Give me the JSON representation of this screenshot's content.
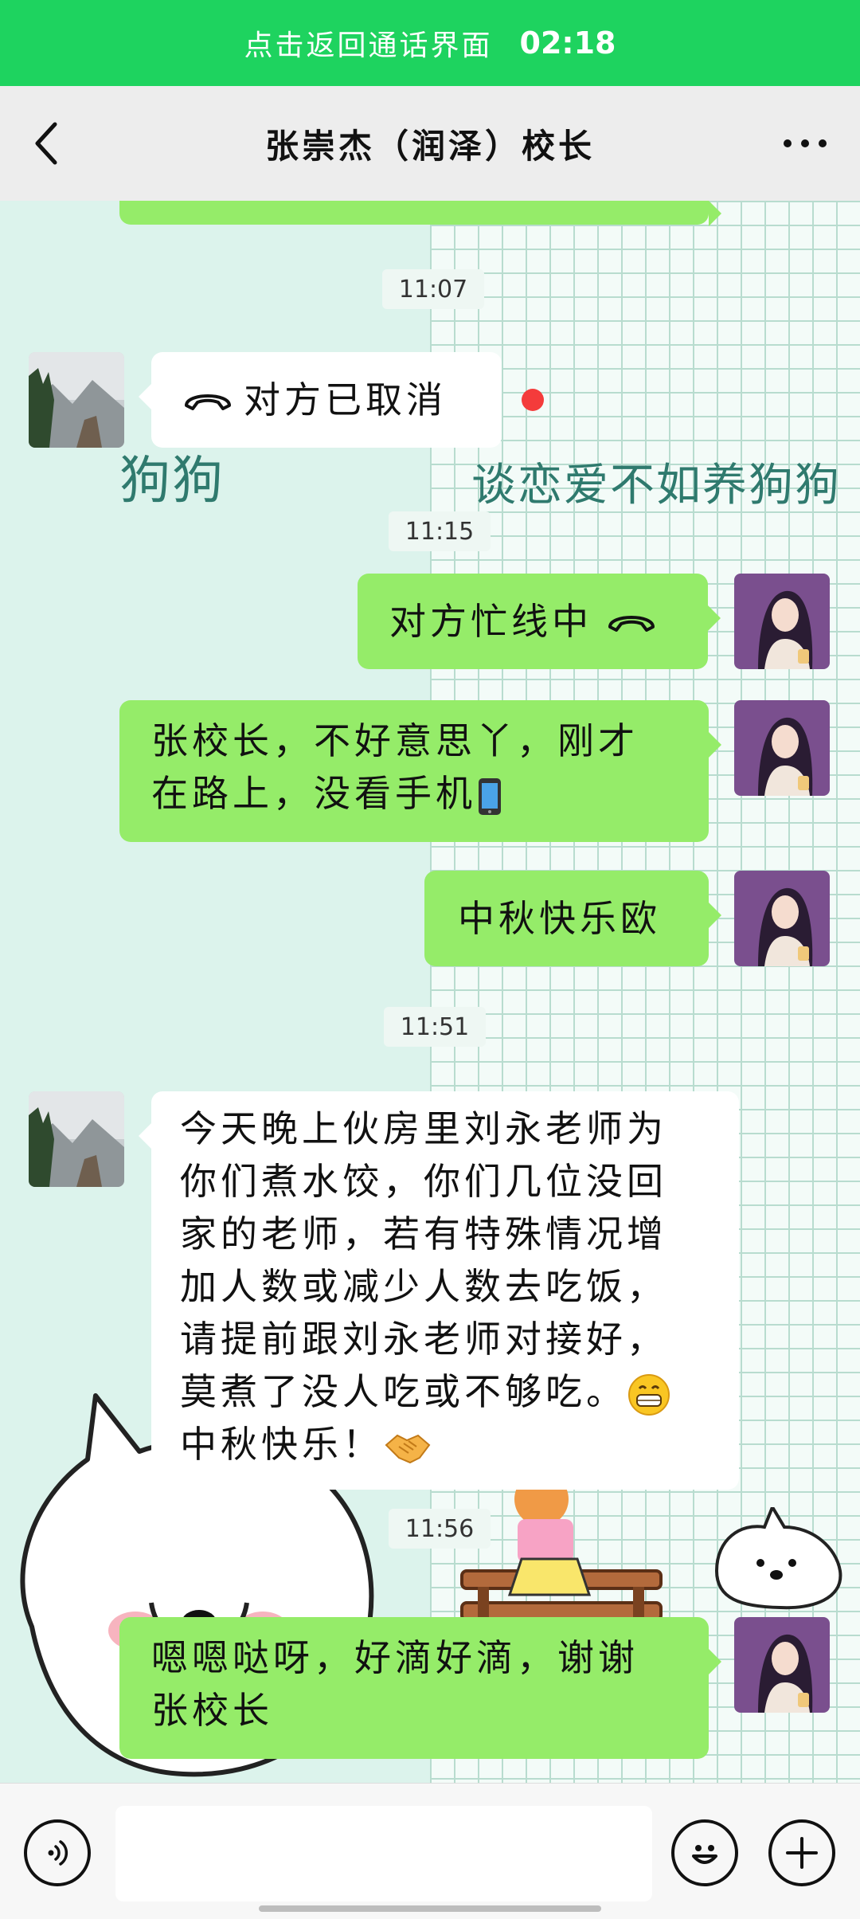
{
  "call_banner": {
    "text": "点击返回通话界面",
    "time": "02:18"
  },
  "header": {
    "title": "张崇杰（润泽）校长"
  },
  "wallpaper_text": {
    "left": "狗狗",
    "right": "谈恋爱不如养狗狗"
  },
  "messages": {
    "ts1": "11:07",
    "call_cancelled": "对方已取消",
    "ts2": "11:15",
    "busy": "对方忙线中",
    "reply1_line1": "张校长，不好意思丫，刚才",
    "reply1_line2": "在路上，没看手机",
    "reply2": "中秋快乐欧",
    "ts3": "11:51",
    "notice_line1": "今天晚上伙房里刘永老师为",
    "notice_line2": "你们煮水饺，你们几位没回",
    "notice_line3": "家的老师，若有特殊情况增",
    "notice_line4": "加人数或减少人数去吃饭，",
    "notice_line5": "请提前跟刘永老师对接好，",
    "notice_line6": "莫煮了没人吃或不够吃。",
    "notice_line7": "中秋快乐！",
    "ts4": "11:56",
    "reply3_line1": "嗯嗯哒呀，好滴好滴，谢谢",
    "reply3_line2": "张校长"
  },
  "icons": {
    "back": "chevron-left-icon",
    "more": "more-dots-icon",
    "voice": "voice-icon",
    "emoji": "smiley-icon",
    "plus": "plus-icon"
  },
  "colors": {
    "banner": "#1ed35f",
    "outgoing_bubble": "#95ec69",
    "incoming_bubble": "#ffffff",
    "unread_dot": "#f43b3b"
  }
}
